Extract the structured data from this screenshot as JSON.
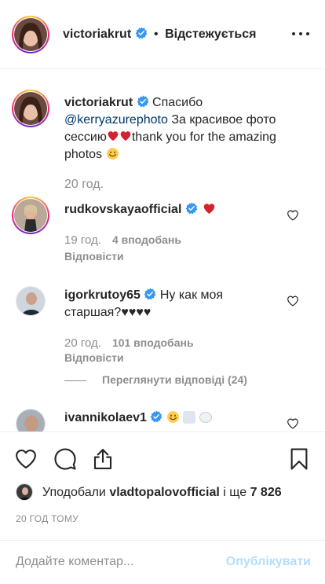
{
  "header": {
    "username": "victoriakrut",
    "separator": "•",
    "follow_status": "Відстежується"
  },
  "caption": {
    "username": "victoriakrut",
    "text_before": "Спасибо",
    "mention": "@kerryazurephoto",
    "text_after": "За красивое фото сессию",
    "text_end": "thank you for the amazing photos",
    "time": "20 год."
  },
  "comments": [
    {
      "username": "rudkovskayaofficial",
      "text": "",
      "time": "19 год.",
      "likes": "4 вподобань",
      "reply": "Відповісти"
    },
    {
      "username": "igorkrutoy65",
      "text": "Ну как моя старшая?♥♥♥♥",
      "time": "20 год.",
      "likes": "101 вподобань",
      "reply": "Відповісти",
      "view_replies": "Переглянути відповіді (24)"
    },
    {
      "username": "ivannikolaev1",
      "text": ""
    }
  ],
  "likes_line": {
    "prefix": "Уподобали",
    "user": "vladtopalovofficial",
    "middle": "і ще",
    "count": "7 826"
  },
  "time_ago": "20 ГОД ТОМУ",
  "add_comment": {
    "placeholder": "Додайте коментар...",
    "post_label": "Опублікувати"
  },
  "colors": {
    "verified": "#3897f0",
    "red_heart": "#d1242f",
    "post_disabled": "#b2dffc",
    "muted": "#8e8e8e"
  },
  "icons": [
    "heart-outline-icon",
    "comment-bubble-icon",
    "share-icon",
    "bookmark-icon",
    "more-dots-icon",
    "verified-badge-icon"
  ]
}
